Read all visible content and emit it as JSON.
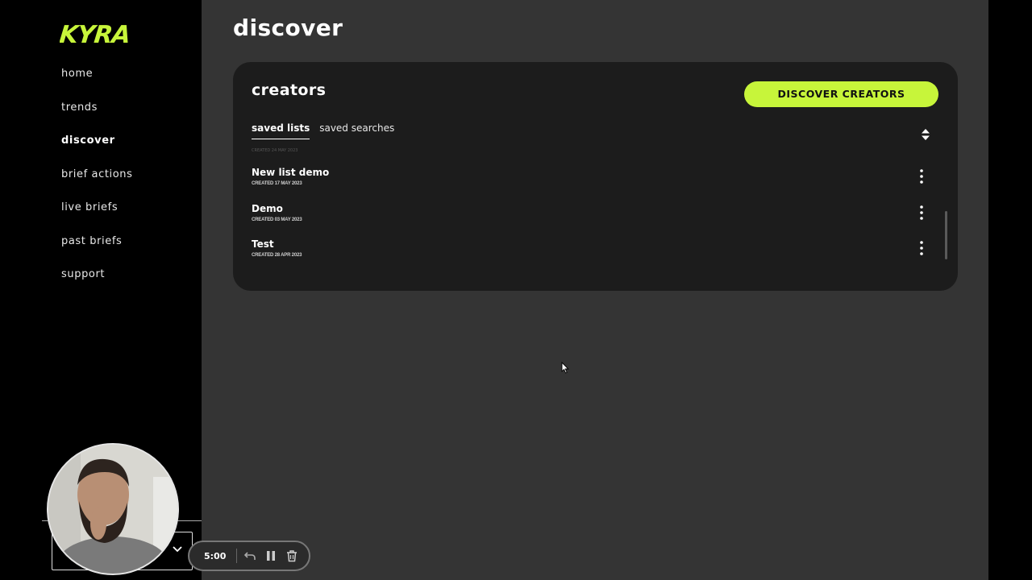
{
  "brand": {
    "logo_text": "KYRA",
    "accent": "#c7f53a"
  },
  "nav": {
    "items": [
      {
        "label": "home"
      },
      {
        "label": "trends"
      },
      {
        "label": "discover",
        "active": true
      },
      {
        "label": "brief actions"
      },
      {
        "label": "live briefs"
      },
      {
        "label": "past briefs"
      },
      {
        "label": "support"
      }
    ]
  },
  "page": {
    "title": "discover"
  },
  "creators": {
    "title": "creators",
    "cta_label": "DISCOVER CREATORS",
    "tabs": [
      {
        "label": "saved lists",
        "active": true
      },
      {
        "label": "saved searches"
      }
    ],
    "ghost_text": "CREATED 24 MAY 2023",
    "lists": [
      {
        "name": "New list demo",
        "created": "CREATED 17 MAY 2023"
      },
      {
        "name": "Demo",
        "created": "CREATED 03 MAY 2023"
      },
      {
        "name": "Test",
        "created": "CREATED 28 APR 2023"
      }
    ]
  },
  "recorder": {
    "time": "5:00"
  }
}
